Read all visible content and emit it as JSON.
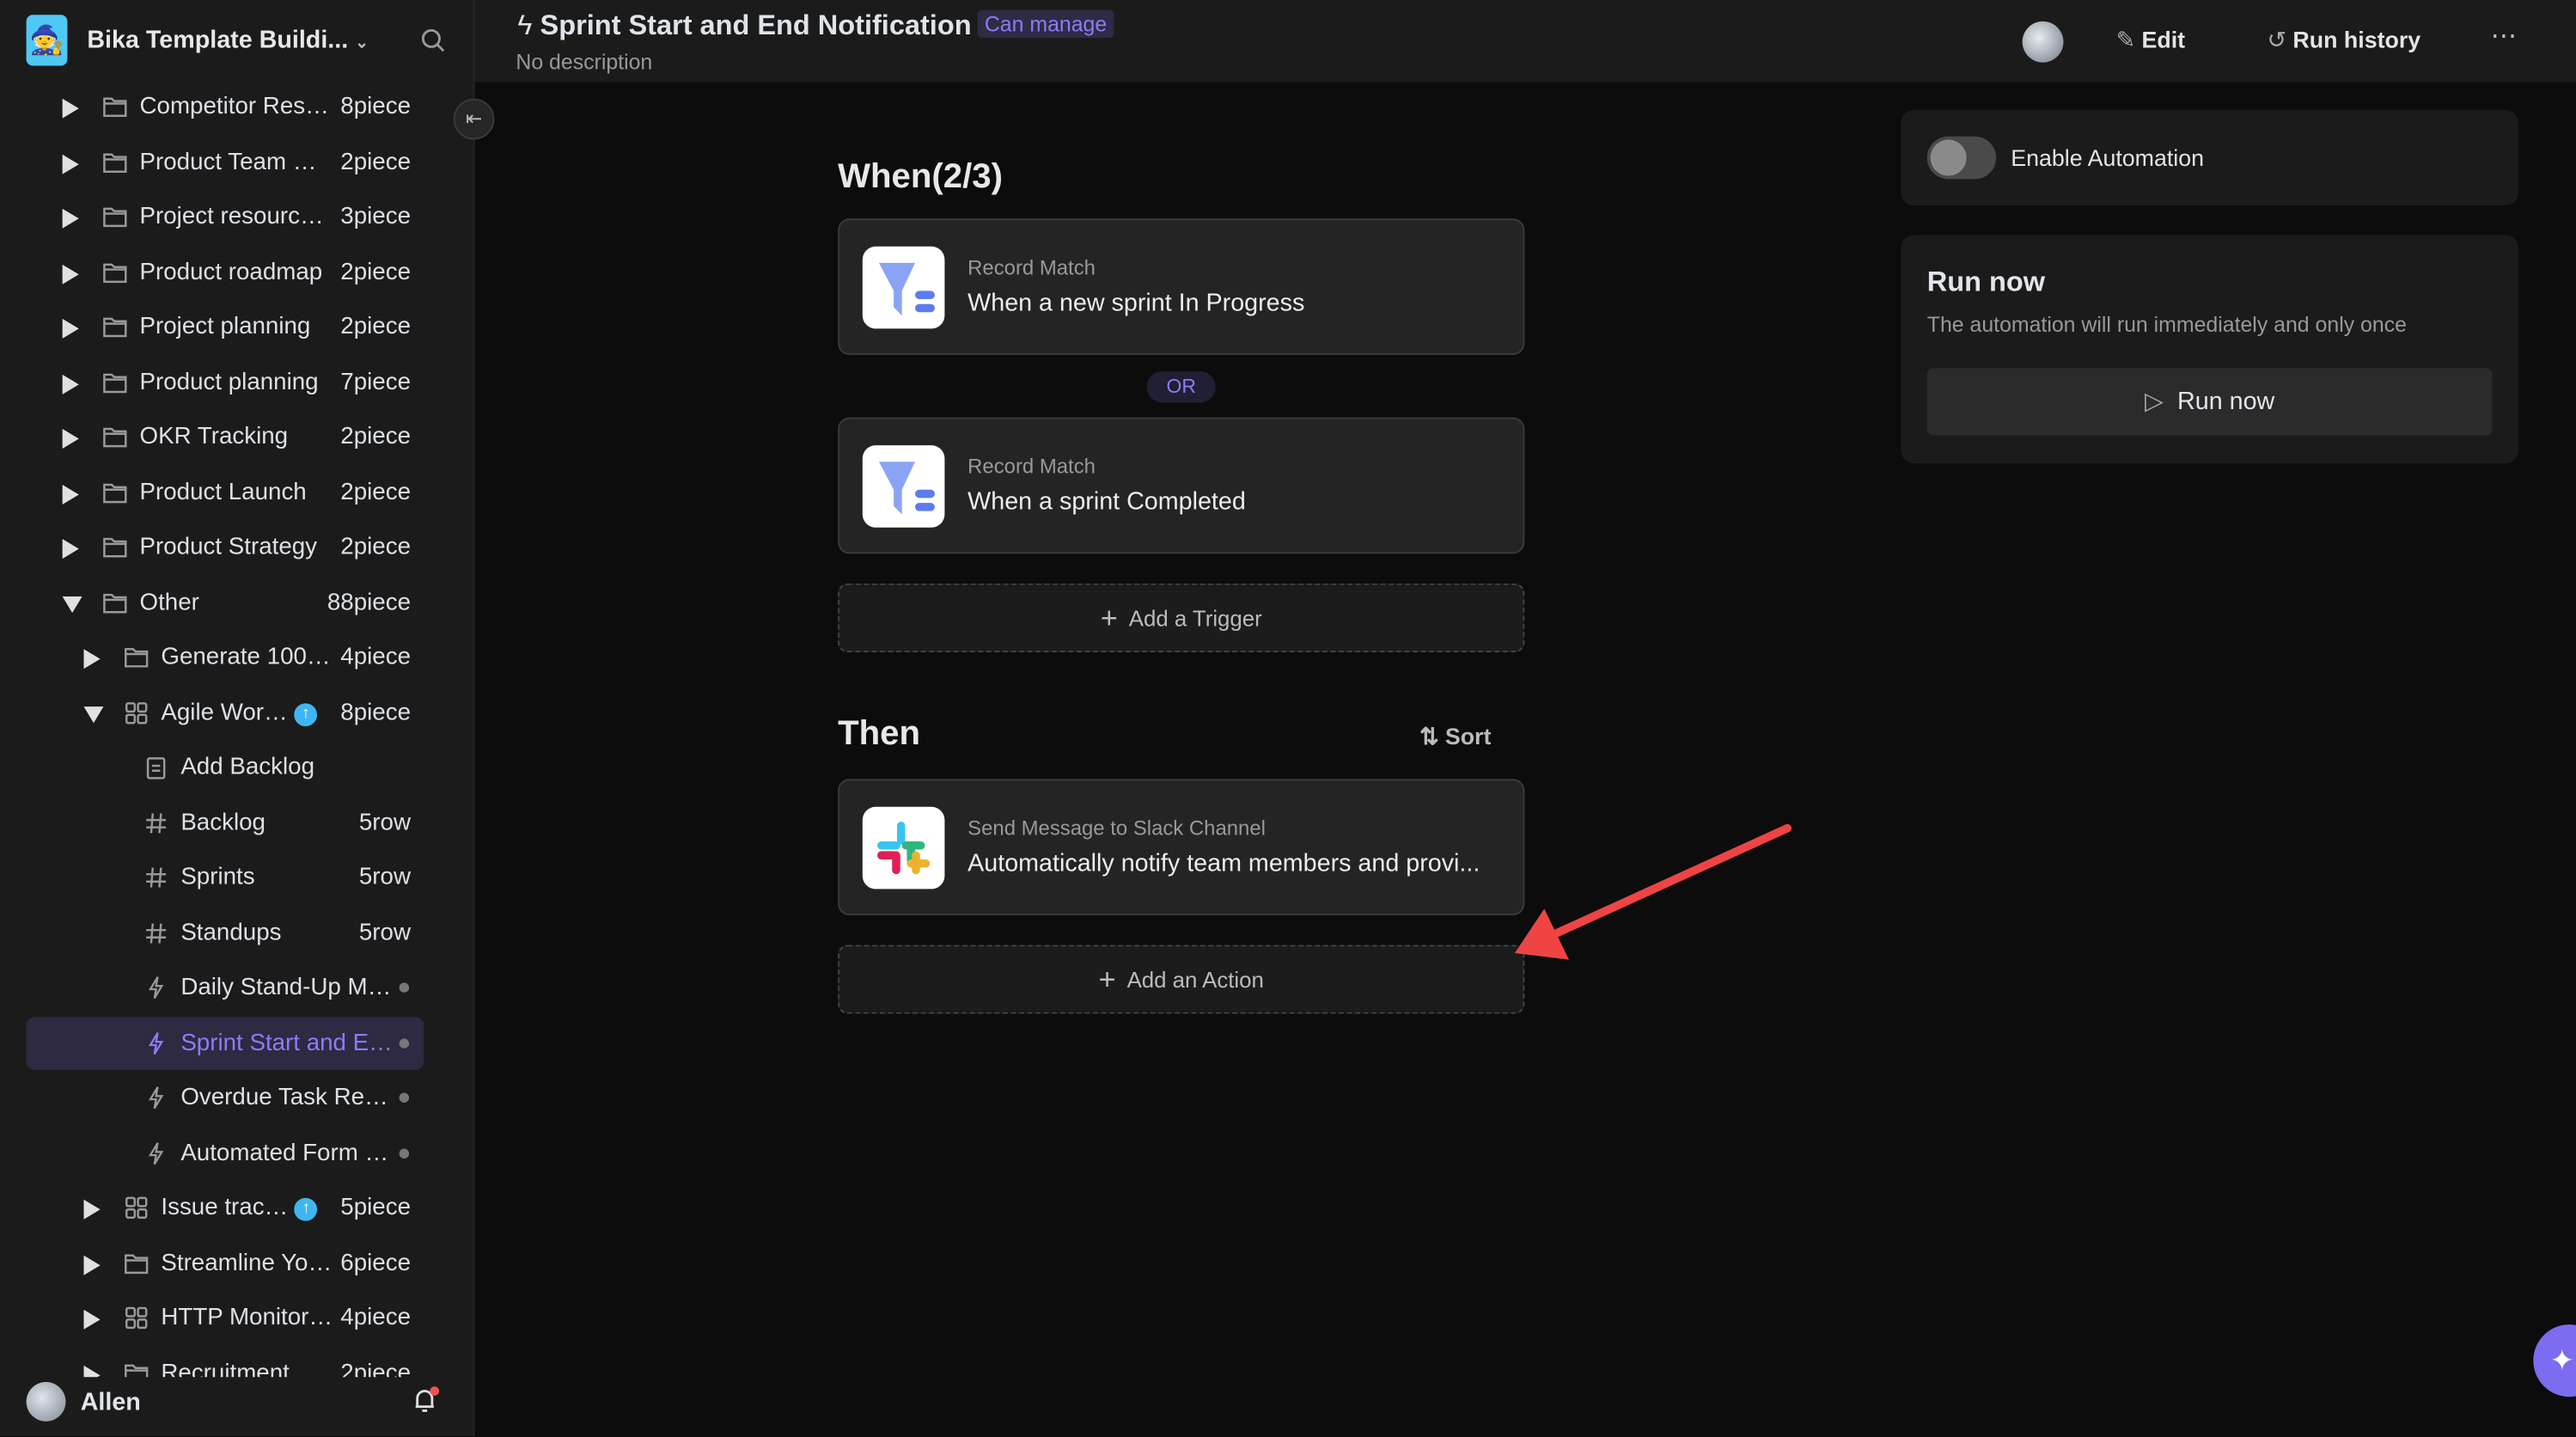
{
  "sidebar": {
    "space_name": "Bika Template Buildi...",
    "items": [
      {
        "label": "Competitor Res…",
        "count": "8piece"
      },
      {
        "label": "Product Team …",
        "count": "2piece"
      },
      {
        "label": "Project resourc…",
        "count": "3piece"
      },
      {
        "label": "Product roadmap",
        "count": "2piece"
      },
      {
        "label": "Project planning",
        "count": "2piece"
      },
      {
        "label": "Product planning",
        "count": "7piece"
      },
      {
        "label": "OKR Tracking",
        "count": "2piece"
      },
      {
        "label": "Product Launch",
        "count": "2piece"
      },
      {
        "label": "Product Strategy",
        "count": "2piece"
      },
      {
        "label": "Other",
        "count": "88piece"
      },
      {
        "label": "Generate 100…",
        "count": "4piece"
      },
      {
        "label": "Agile Wor…",
        "count": "8piece"
      },
      {
        "label": "Add Backlog"
      },
      {
        "label": "Backlog",
        "count": "5row"
      },
      {
        "label": "Sprints",
        "count": "5row"
      },
      {
        "label": "Standups",
        "count": "5row"
      },
      {
        "label": "Daily Stand-Up M…"
      },
      {
        "label": "Sprint Start and E…"
      },
      {
        "label": "Overdue Task Re…"
      },
      {
        "label": "Automated Form …"
      },
      {
        "label": "Issue trac…",
        "count": "5piece"
      },
      {
        "label": "Streamline Yo…",
        "count": "6piece"
      },
      {
        "label": "HTTP Monitor…",
        "count": "4piece"
      },
      {
        "label": "Recruitment",
        "count": "2piece"
      }
    ],
    "user_name": "Allen"
  },
  "header": {
    "title": "Sprint Start and End Notification",
    "permission": "Can manage",
    "description": "No description",
    "edit_label": "Edit",
    "run_history_label": "Run history"
  },
  "when": {
    "title": "When(2/3)",
    "triggers": [
      {
        "type": "Record Match",
        "text": "When a new sprint In Progress"
      },
      {
        "type": "Record Match",
        "text": "When a sprint Completed"
      }
    ],
    "or_label": "OR",
    "add_trigger_label": "Add a Trigger"
  },
  "then": {
    "title": "Then",
    "sort_label": "Sort",
    "actions": [
      {
        "type": "Send Message to Slack Channel",
        "text": "Automatically notify team members and provi..."
      }
    ],
    "add_action_label": "Add an Action"
  },
  "panel": {
    "enable_label": "Enable Automation",
    "enabled": false,
    "run_now_title": "Run now",
    "run_now_desc": "The automation will run immediately and only once",
    "run_now_button": "Run now"
  },
  "colors": {
    "accent": "#8b7cf6",
    "annotation_arrow": "#ef4444"
  }
}
